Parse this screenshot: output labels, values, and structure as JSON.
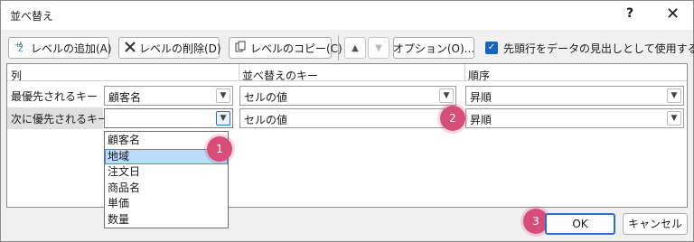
{
  "window": {
    "title": "並べ替え",
    "help_label": "?",
    "close_label": "✕"
  },
  "toolbar": {
    "add_level": "レベルの追加(A)",
    "delete_level": "レベルの削除(D)",
    "copy_level": "レベルのコピー(C)",
    "move_up": "▲",
    "move_down": "▼",
    "options": "オプション(O)...",
    "has_headers_checked": true,
    "has_headers_check": "✓",
    "has_headers_label": "先頭行をデータの見出しとして使用する(H)"
  },
  "grid": {
    "headers": {
      "column": "列",
      "sort_on": "並べ替えのキー",
      "order": "順序"
    },
    "rows": [
      {
        "label": "最優先されるキー",
        "column": "顧客名",
        "sort_on": "セルの値",
        "order": "昇順"
      },
      {
        "label": "次に優先されるキー",
        "column": "",
        "sort_on": "セルの値",
        "order": "昇順"
      }
    ],
    "dropdown_options": [
      "顧客名",
      "地域",
      "注文日",
      "商品名",
      "単価",
      "数量"
    ],
    "dropdown_selected": "地域"
  },
  "badges": [
    "1",
    "2",
    "3"
  ],
  "buttons": {
    "ok": "OK",
    "cancel": "キャンセル"
  },
  "colors": {
    "accent": "#2a6fd1",
    "badge": "#d64d7a",
    "checkbox": "#1565c0",
    "dropdown_highlight": "#bcdcf7"
  }
}
